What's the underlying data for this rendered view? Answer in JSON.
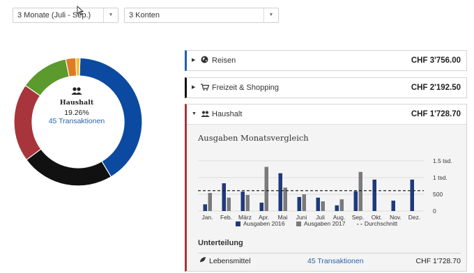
{
  "filters": {
    "period": "3 Monate (Juli - Sep.)",
    "accounts": "3 Konten"
  },
  "donut": {
    "title": "Haushalt",
    "percent": "19.26%",
    "transactions": "45 Transaktionen",
    "slices": [
      {
        "color": "#0b4aa0",
        "value": 40
      },
      {
        "color": "#111111",
        "value": 23
      },
      {
        "color": "#a8353b",
        "value": 19.26
      },
      {
        "color": "#5d9a2e",
        "value": 12
      },
      {
        "color": "#e07b25",
        "value": 2.5
      },
      {
        "color": "#f1c232",
        "value": 1
      }
    ]
  },
  "categories": [
    {
      "name": "Reisen",
      "amount": "CHF 3'756.00",
      "icon": "globe-icon",
      "accent": "#1f5fb0"
    },
    {
      "name": "Freizeit & Shopping",
      "amount": "CHF 2'192.50",
      "icon": "cart-icon",
      "accent": "#111111"
    },
    {
      "name": "Haushalt",
      "amount": "CHF 1'728.70",
      "icon": "people-icon",
      "accent": "#a8353b"
    }
  ],
  "chart_data": {
    "type": "bar",
    "title": "Ausgaben Monatsvergleich",
    "categories": [
      "Jan.",
      "Feb.",
      "März",
      "Apr.",
      "Mai",
      "Juni",
      "Juli",
      "Aug.",
      "Sep.",
      "Okt.",
      "Nov.",
      "Dez."
    ],
    "series": [
      {
        "name": "Ausgaben 2016",
        "color": "#1e3a7b",
        "values": [
          200,
          830,
          580,
          250,
          1130,
          420,
          400,
          170,
          590,
          940,
          310,
          940
        ]
      },
      {
        "name": "Ausgaben 2017",
        "color": "#7a7a7a",
        "values": [
          540,
          400,
          480,
          1320,
          700,
          500,
          290,
          350,
          1170,
          null,
          null,
          null
        ]
      }
    ],
    "average": {
      "name": "Durchschnitt",
      "value": 610
    },
    "ylim": [
      0,
      1500
    ],
    "yticks": [
      {
        "v": 0,
        "label": "0"
      },
      {
        "v": 500,
        "label": "500"
      },
      {
        "v": 1000,
        "label": "1 tsd."
      },
      {
        "v": 1500,
        "label": "1.5 tsd."
      }
    ]
  },
  "subdivision": {
    "title": "Unterteilung",
    "item": {
      "label": "Lebensmittel",
      "transactions": "45 Transaktionen",
      "amount": "CHF 1'728.70"
    }
  }
}
